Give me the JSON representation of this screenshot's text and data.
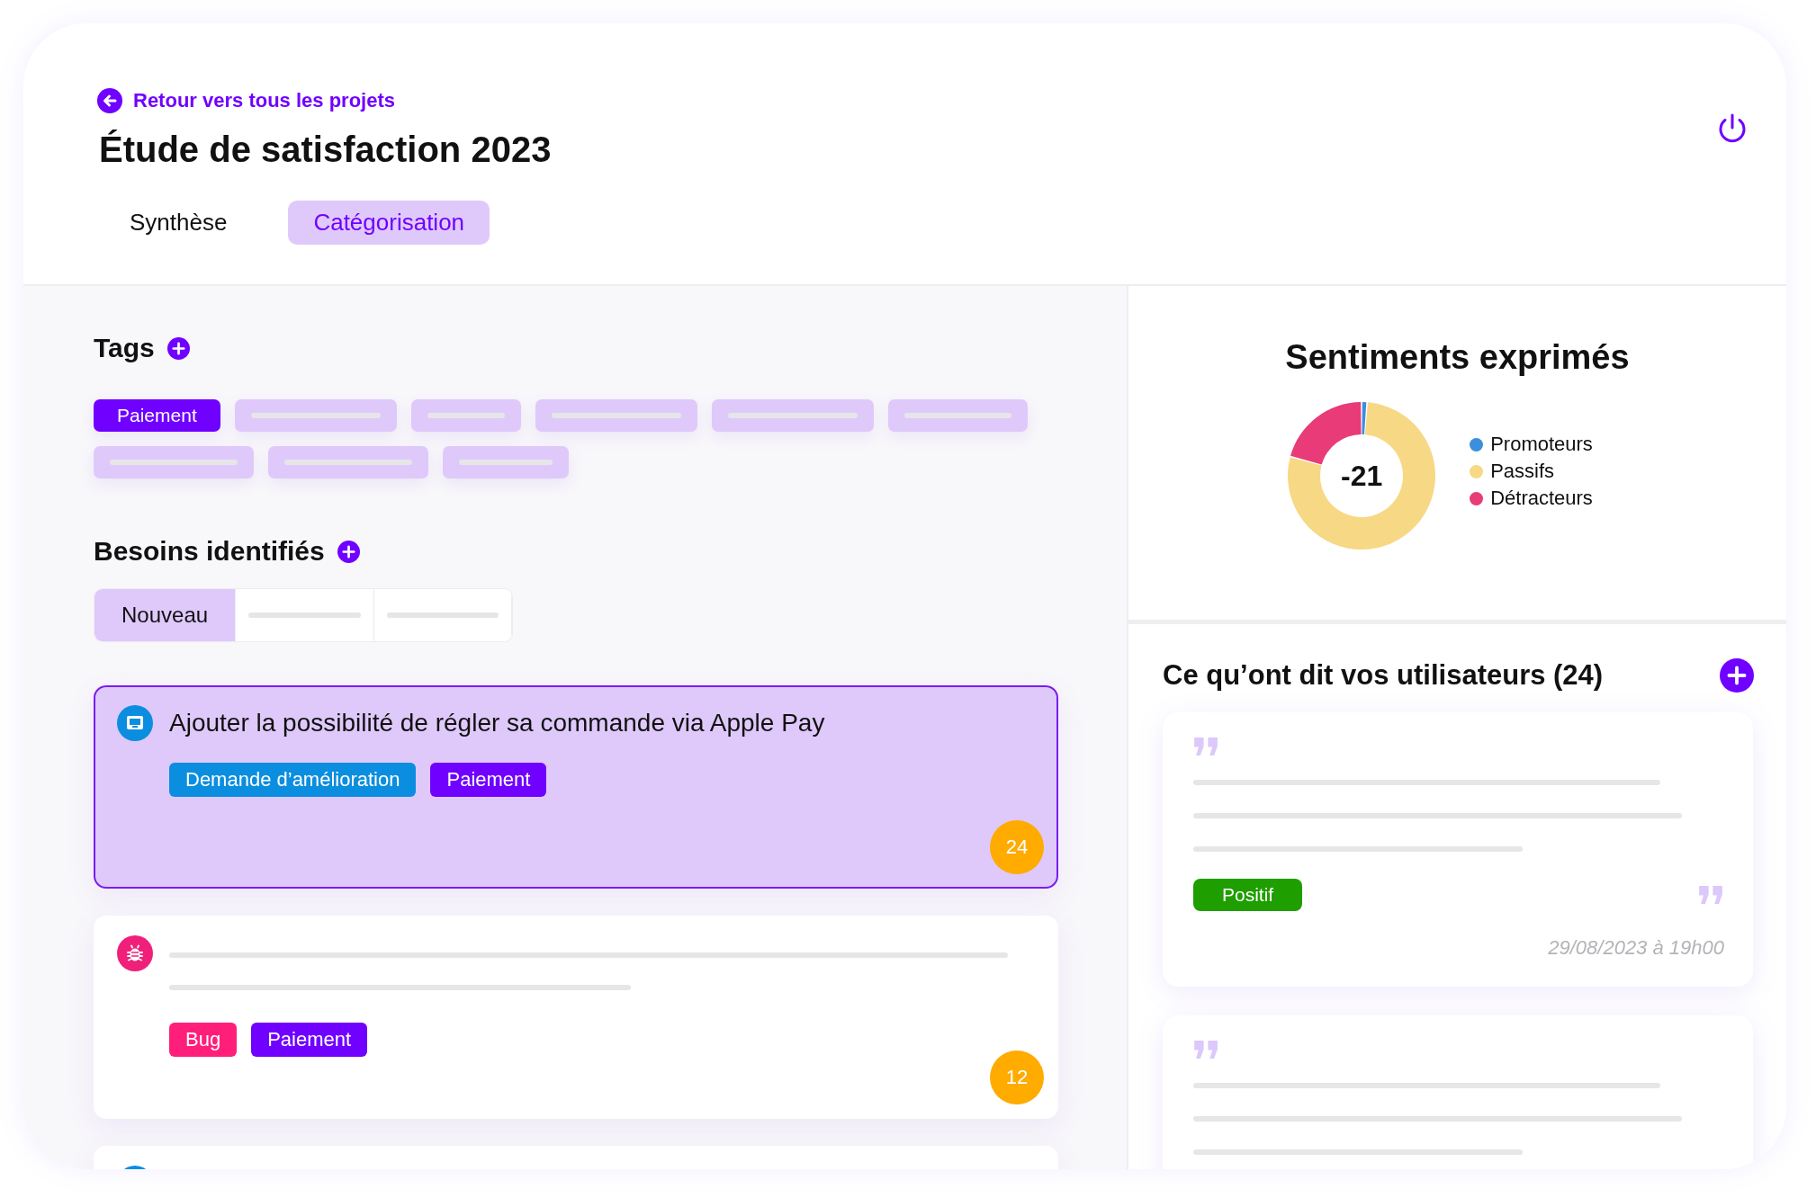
{
  "header": {
    "back_link": "Retour vers tous les projets",
    "title": "Étude de satisfaction 2023"
  },
  "tabs": [
    {
      "label": "Synthèse",
      "selected": false
    },
    {
      "label": "Catégorisation",
      "selected": true
    }
  ],
  "tags": {
    "title": "Tags",
    "items": [
      {
        "label": "Paiement",
        "selected": true
      }
    ]
  },
  "needs": {
    "title": "Besoins identifiés",
    "filters": [
      {
        "label": "Nouveau",
        "selected": true
      }
    ],
    "items": [
      {
        "kind": "improvement",
        "selected": true,
        "title": "Ajouter la possibilité de régler sa commande via Apple Pay",
        "tags": [
          {
            "label": "Demande d’amélioration",
            "color": "#0b8ee0"
          },
          {
            "label": "Paiement",
            "color": "#7000ff"
          }
        ],
        "count": "24"
      },
      {
        "kind": "bug",
        "selected": false,
        "tags": [
          {
            "label": "Bug",
            "color": "#ff1f7a"
          },
          {
            "label": "Paiement",
            "color": "#7000ff"
          }
        ],
        "count": "12"
      },
      {
        "kind": "improvement",
        "selected": false
      }
    ]
  },
  "sentiments": {
    "title": "Sentiments exprimés",
    "score": "-21",
    "legend": [
      {
        "label": "Promoteurs",
        "color": "#3b8fdc"
      },
      {
        "label": "Passifs",
        "color": "#f7d885"
      },
      {
        "label": "Détracteurs",
        "color": "#e83b78"
      }
    ]
  },
  "feedback": {
    "title": "Ce qu’ont dit vos utilisateurs (24)",
    "quotes": [
      {
        "kind": "tagged",
        "sentiment": "Positif",
        "color": "#1f9e00",
        "date": "29/08/2023 à 19h00"
      },
      {
        "kind": "plain"
      }
    ]
  }
}
